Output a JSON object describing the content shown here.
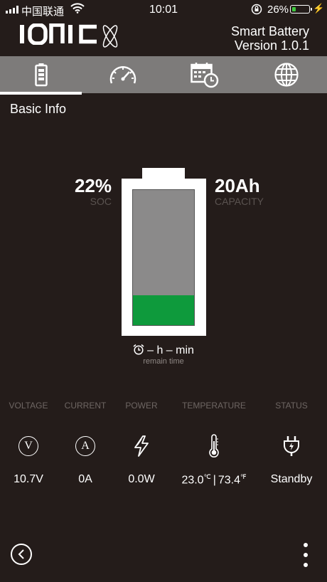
{
  "status_bar": {
    "carrier": "中国联通",
    "time": "10:01",
    "battery_percent": "26%",
    "battery_level": 0.26,
    "icons": [
      "signal-icon",
      "wifi-icon",
      "rotation-lock-icon",
      "battery-icon",
      "charging-icon"
    ]
  },
  "header": {
    "logo": "IONIC",
    "title": "Smart Battery",
    "version": "Version 1.0.1"
  },
  "tabs": [
    {
      "icon": "battery-icon",
      "selected": true
    },
    {
      "icon": "speedometer-icon",
      "selected": false
    },
    {
      "icon": "calendar-clock-icon",
      "selected": false
    },
    {
      "icon": "globe-icon",
      "selected": false
    }
  ],
  "section_title": "Basic Info",
  "battery": {
    "soc_value": "22%",
    "soc_label": "SOC",
    "soc_level": 0.22,
    "capacity_value": "20Ah",
    "capacity_label": "CAPACITY",
    "remain_value": "– h – min",
    "remain_label": "remain time"
  },
  "metrics": {
    "voltage": {
      "label": "VOLTAGE",
      "value": "10.7V",
      "icon_letter": "V"
    },
    "current": {
      "label": "CURRENT",
      "value": "0A",
      "icon_letter": "A"
    },
    "power": {
      "label": "POWER",
      "value": "0.0W"
    },
    "temperature": {
      "label": "TEMPERATURE",
      "celsius": "23.0",
      "c_unit": "℃",
      "fahrenheit": "73.4",
      "f_unit": "℉",
      "separator": "|"
    },
    "status": {
      "label": "STATUS",
      "value": "Standby"
    }
  },
  "colors": {
    "background": "#241c1a",
    "tab_bar": "#7d7b7a",
    "battery_fill": "#0e9a3c",
    "battery_empty": "#8b8a8a",
    "muted_label": "#5a5350"
  }
}
